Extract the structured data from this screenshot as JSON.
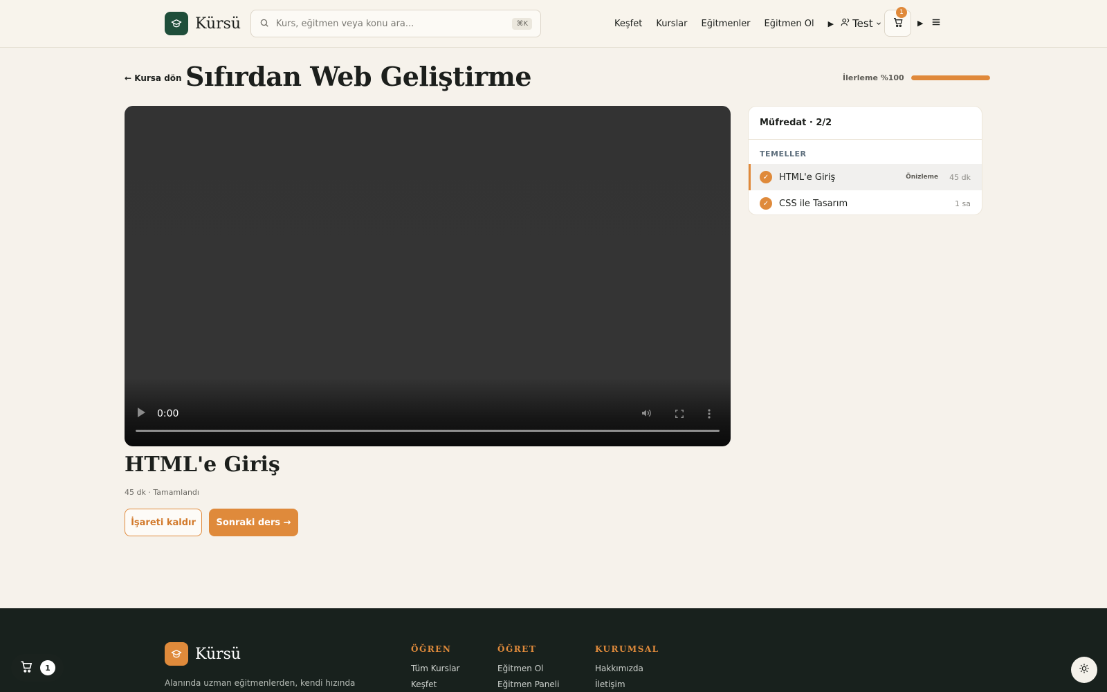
{
  "header": {
    "brand": "Kürsü",
    "search_placeholder": "Kurs, eğitmen veya konu ara...",
    "search_shortcut": "⌘K",
    "nav": [
      "Keşfet",
      "Kurslar",
      "Eğitmenler",
      "Eğitmen Ol"
    ],
    "nav_play_icon": "▶",
    "user_name": "Test",
    "cart_count": "1",
    "play_icon_2": "▶"
  },
  "page": {
    "back_label": "← Kursa dön",
    "title": "Sıfırdan Web Geliştirme",
    "progress_label": "İlerleme %100",
    "progress_fraction": 1.0
  },
  "video": {
    "time": "0:00"
  },
  "lesson": {
    "title": "HTML'e Giriş",
    "meta": "45 dk · Tamamlandı",
    "unmark_label": "İşareti kaldır",
    "next_label": "Sonraki ders →"
  },
  "curriculum": {
    "heading": "Müfredat · 2/2",
    "section": "TEMELLER",
    "items": [
      {
        "label": "HTML'e Giriş",
        "tag": "Önizleme",
        "duration": "45 dk",
        "check": "✓"
      },
      {
        "label": "CSS ile Tasarım",
        "tag": "",
        "duration": "1 sa",
        "check": "✓"
      }
    ]
  },
  "footer": {
    "brand": "Kürsü",
    "description": "Alanında uzman eğitmenlerden, kendi hızında",
    "columns": [
      {
        "title": "ÖĞREN",
        "links": [
          "Tüm Kurslar",
          "Keşfet"
        ]
      },
      {
        "title": "ÖĞRET",
        "links": [
          "Eğitmen Ol",
          "Eğitmen Paneli"
        ]
      },
      {
        "title": "KURUMSAL",
        "links": [
          "Hakkımızda",
          "İletişim"
        ]
      }
    ]
  },
  "floating_cart": {
    "count": "1"
  },
  "colors": {
    "accent": "#df8a3b",
    "brand_green": "#1f4e3a",
    "footer_bg": "#18211d",
    "page_bg": "#f6f2eb"
  },
  "icons": [
    "graduation-cap-icon",
    "search-icon",
    "user-icon",
    "chevron-down-icon",
    "cart-icon",
    "menu-icon",
    "play-icon",
    "volume-icon",
    "fullscreen-icon",
    "more-vertical-icon",
    "check-icon",
    "sun-icon"
  ]
}
